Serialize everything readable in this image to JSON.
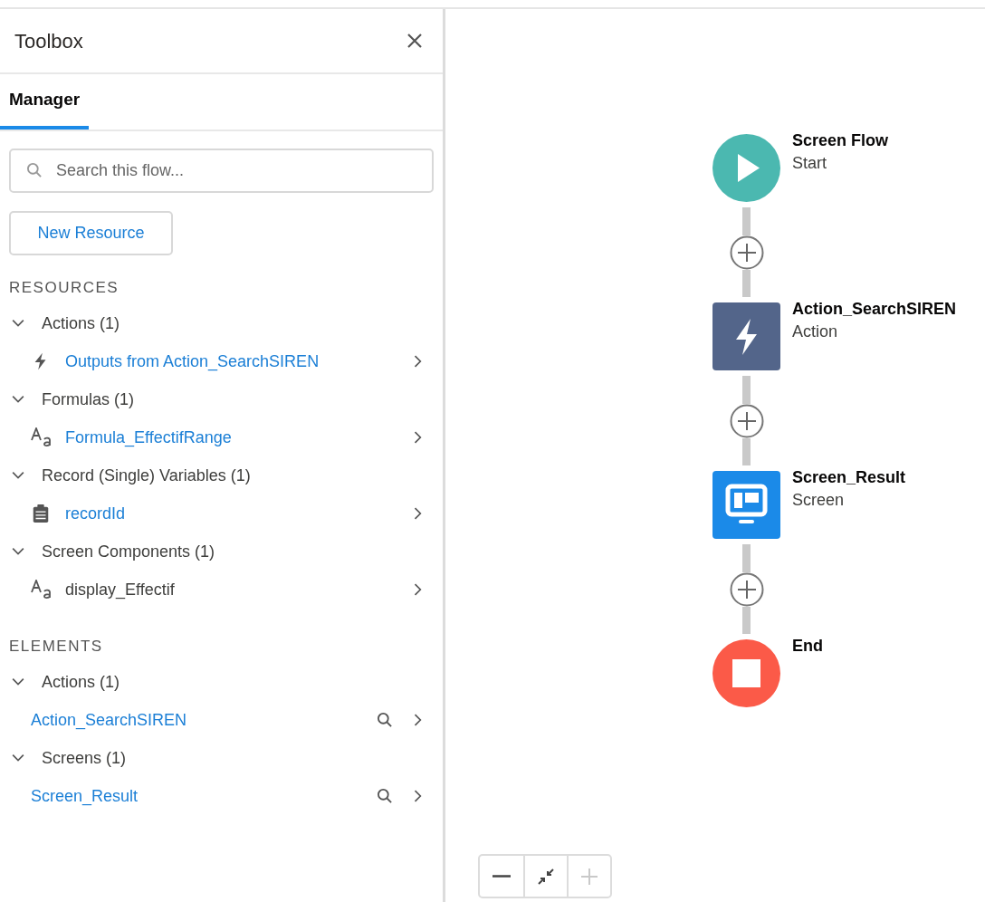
{
  "toolbox": {
    "title": "Toolbox",
    "tabs": [
      {
        "label": "Manager",
        "selected": true
      }
    ],
    "search": {
      "placeholder": "Search this flow..."
    },
    "new_resource_button": "New Resource",
    "sections": [
      {
        "heading": "RESOURCES",
        "groups": [
          {
            "label": "Actions (1)",
            "expanded": true,
            "children": [
              {
                "kind": "action",
                "label": "Outputs from Action_SearchSIREN",
                "link": true
              }
            ]
          },
          {
            "label": "Formulas (1)",
            "expanded": true,
            "children": [
              {
                "kind": "text",
                "label": "Formula_EffectifRange",
                "link": true
              }
            ]
          },
          {
            "label": "Record (Single) Variables (1)",
            "expanded": true,
            "children": [
              {
                "kind": "record",
                "label": "recordId",
                "link": true
              }
            ]
          },
          {
            "label": "Screen Components (1)",
            "expanded": true,
            "children": [
              {
                "kind": "text",
                "label": "display_Effectif",
                "link": false
              }
            ]
          }
        ]
      },
      {
        "heading": "ELEMENTS",
        "groups": [
          {
            "label": "Actions (1)",
            "expanded": true,
            "children": [
              {
                "kind": "element",
                "label": "Action_SearchSIREN",
                "link": true
              }
            ]
          },
          {
            "label": "Screens (1)",
            "expanded": true,
            "children": [
              {
                "kind": "element",
                "label": "Screen_Result",
                "link": true
              }
            ]
          }
        ]
      }
    ]
  },
  "canvas": {
    "nodes": [
      {
        "kind": "start",
        "title": "Screen Flow",
        "subtitle": "Start"
      },
      {
        "kind": "action",
        "title": "Action_SearchSIREN",
        "subtitle": "Action"
      },
      {
        "kind": "screen",
        "title": "Screen_Result",
        "subtitle": "Screen"
      },
      {
        "kind": "end",
        "title": "End"
      }
    ],
    "zoom_controls": [
      {
        "kind": "zoom-out",
        "disabled": false
      },
      {
        "kind": "fit",
        "disabled": false
      },
      {
        "kind": "zoom-in",
        "disabled": true
      }
    ]
  }
}
